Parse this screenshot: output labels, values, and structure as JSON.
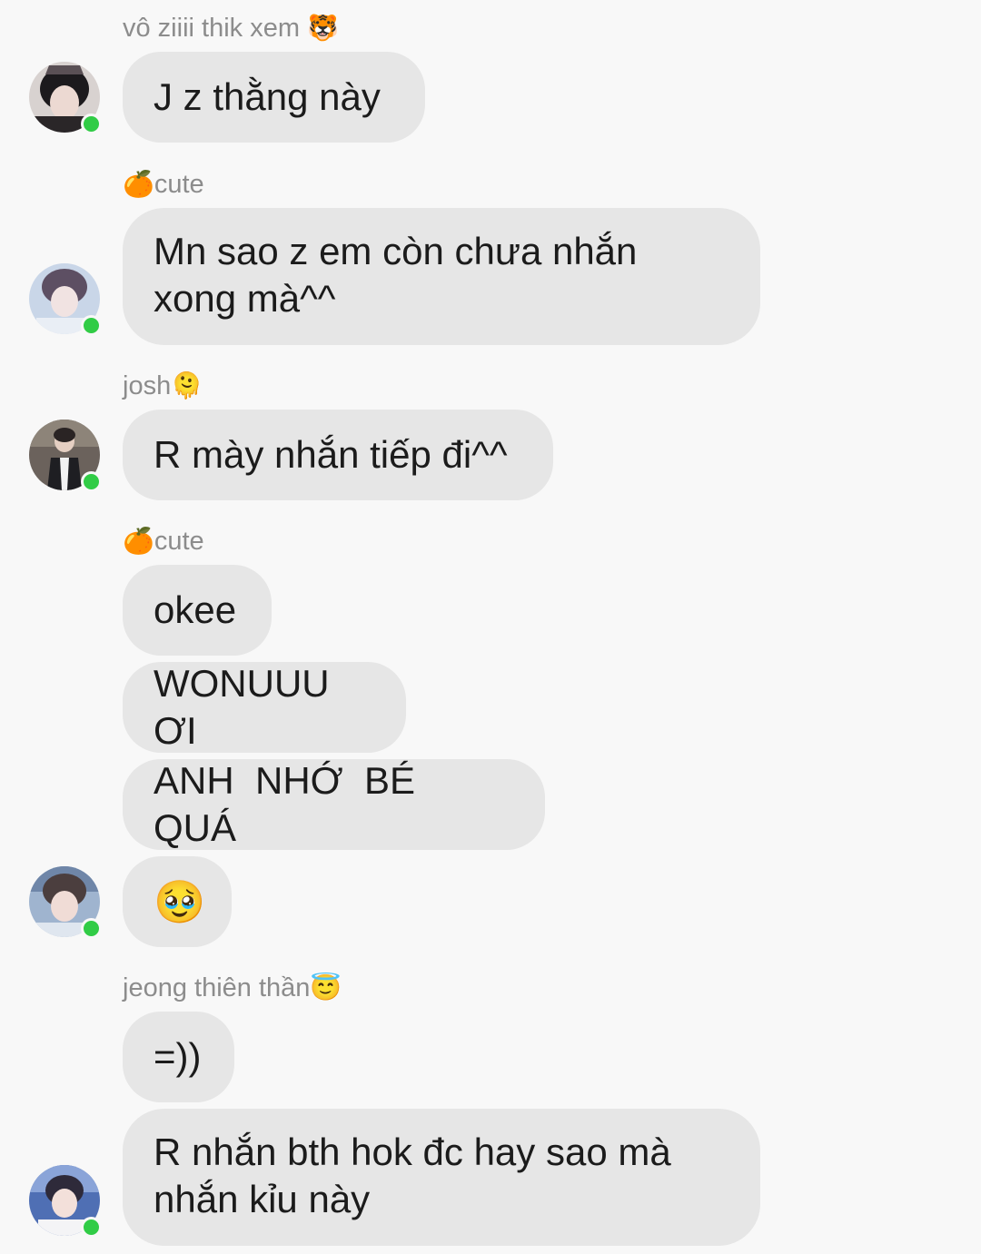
{
  "messages": [
    {
      "sender": "vô ziiii thik xem",
      "sender_emoji": "🐯",
      "bubbles": [
        "J z thằng này"
      ]
    },
    {
      "sender": "cute",
      "sender_emoji": "🍊",
      "bubbles": [
        "Mn sao z em còn chưa nhắn xong mà^^"
      ]
    },
    {
      "sender": "josh",
      "sender_emoji": "🫠",
      "bubbles": [
        "R mày nhắn tiếp đi^^"
      ]
    },
    {
      "sender": "cute",
      "sender_emoji": "🍊",
      "bubbles": [
        "okee",
        "WONUUU ƠI",
        "ANH  NHỚ  BÉ  QUÁ",
        "🥹"
      ]
    },
    {
      "sender": "jeong thiên thần",
      "sender_emoji": "😇",
      "bubbles": [
        "=))",
        "R nhắn bth hok đc hay sao mà nhắn kỉu này"
      ]
    }
  ],
  "colors": {
    "background": "#f8f8f8",
    "bubble": "#e6e6e6",
    "sender_text": "#8c8c8c",
    "online_dot": "#31cc46"
  },
  "icons": {
    "online": "online-status-dot",
    "avatar": "user-avatar"
  }
}
